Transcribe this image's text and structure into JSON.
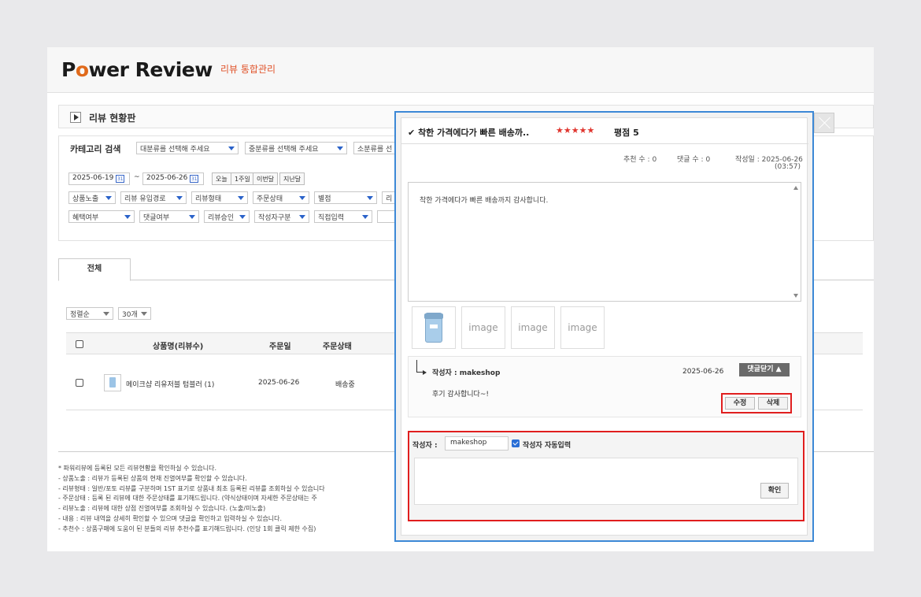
{
  "header": {
    "logo_text": "Power Review",
    "subtitle": "리뷰 통합관리"
  },
  "board": {
    "title": "리뷰 현황판"
  },
  "search": {
    "category_label": "카테고리 검색",
    "category_selects": [
      "대분류를 선택해 주세요",
      "중분류를 선택해 주세요",
      "소분류를 선"
    ],
    "date_from": "2025-06-19",
    "date_to": "2025-06-26",
    "calendar_glyph": "31",
    "tilde": "~",
    "quick_buttons": [
      "오늘",
      "1주일",
      "이번달",
      "지난달"
    ],
    "filters_row1": [
      "상품노출",
      "리뷰 유입경로",
      "리뷰형태",
      "주문상태",
      "별점",
      "리"
    ],
    "filters_row2": [
      "혜택여부",
      "댓글여부",
      "리뷰승인",
      "작성자구분",
      "직접입력"
    ]
  },
  "tabs": {
    "all": "전체"
  },
  "list": {
    "sort": "정렬순",
    "count": "30개",
    "columns": [
      "상품명(리뷰수)",
      "주문일",
      "주문상태"
    ],
    "rows": [
      {
        "product": "메이크샵 리유저블 텀블러 (1)",
        "order_date": "2025-06-26",
        "status": "배송중"
      }
    ]
  },
  "notes": [
    "* 파워리뷰에 등록된 모든 리뷰현황을 확인하실 수 있습니다.",
    "- 상품노출 : 리뷰가 등록된 상품의 현재 진열여부를 확인할 수 있습니다.",
    "- 리뷰형태 : 일반/포토 리뷰를 구분하며 1ST 표기로 상품내 최초 등록된 리뷰를 조회하실 수 있습니다",
    "- 주문상태 : 등록 된 리뷰에 대한 주문상태를 표기해드립니다. (약식상태이며 자세한 주문상태는 주",
    "- 리뷰노출 : 리뷰에 대한 상점 진열여부를 조회하실 수 있습니다. (노출/미노출)",
    "- 내용 : 리뷰 내역을 상세히 확인할 수 있으며 댓글을 확인하고 입력하실 수 있습니다.",
    "- 추천수 : 상품구매에 도움이 된 분들의 리뷰 추천수를 표기해드립니다. (인당 1회 클릭 제한 수집)"
  ],
  "popup": {
    "check_glyph": "✔",
    "title": "착한 가격에다가 빠른 배송까..",
    "stars": "★★★★★",
    "score": "평점 5",
    "recommend": "추천 수 : 0",
    "comments": "댓글 수 : 0",
    "created": "작성일 : 2025-06-26",
    "created_time": "(03:57)",
    "content": "착한 가격에다가 빠른 배송까지 감사합니다.",
    "image_placeholder": "image",
    "reply": {
      "author": "작성자 : makeshop",
      "date": "2025-06-26",
      "toggle": "댓글닫기 ▲",
      "body": "후기 감사합니다~!",
      "edit": "수정",
      "delete": "삭제"
    },
    "writer": {
      "label": "작성자 :",
      "name": "makeshop",
      "auto_label": "작성자 자동입력",
      "confirm": "확인"
    }
  }
}
